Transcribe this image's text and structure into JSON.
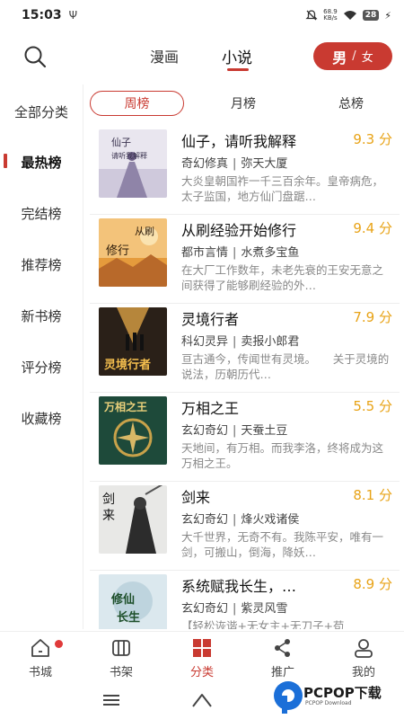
{
  "status_bar": {
    "time": "15:03",
    "left_icon": "usb-icon",
    "net_speed_value": "68.9",
    "net_speed_unit": "KB/s",
    "battery": "28"
  },
  "top_bar": {
    "tabs": [
      {
        "label": "漫画",
        "active": false
      },
      {
        "label": "小说",
        "active": true
      }
    ],
    "gender": {
      "male": "男",
      "separator": "/",
      "female": "女"
    }
  },
  "sidebar": {
    "items": [
      {
        "label": "全部分类",
        "active": false
      },
      {
        "label": "最热榜",
        "active": true
      },
      {
        "label": "完结榜",
        "active": false
      },
      {
        "label": "推荐榜",
        "active": false
      },
      {
        "label": "新书榜",
        "active": false
      },
      {
        "label": "评分榜",
        "active": false
      },
      {
        "label": "收藏榜",
        "active": false
      }
    ]
  },
  "rank_tabs": [
    {
      "label": "周榜",
      "active": true
    },
    {
      "label": "月榜",
      "active": false
    },
    {
      "label": "总榜",
      "active": false
    }
  ],
  "books": [
    {
      "title": "仙子，请听我解释",
      "score": "9.3 分",
      "genre": "奇幻修真",
      "author": "弥天大厦",
      "desc": "大炎皇朝国祚一千三百余年。皇帝病危，太子监国，地方仙门盘踞…"
    },
    {
      "title": "从刷经验开始修行",
      "score": "9.4 分",
      "genre": "都市言情",
      "author": "水煮多宝鱼",
      "desc": "在大厂工作数年，未老先衰的王安无意之间获得了能够刷经验的外…"
    },
    {
      "title": "灵境行者",
      "score": "7.9 分",
      "genre": "科幻灵异",
      "author": "卖报小郎君",
      "desc": "亘古通今，传闻世有灵境。　　关于灵境的说法，历朝历代…"
    },
    {
      "title": "万相之王",
      "score": "5.5 分",
      "genre": "玄幻奇幻",
      "author": "天蚕土豆",
      "desc": "天地间，有万相。而我李洛，终将成为这万相之王。"
    },
    {
      "title": "剑来",
      "score": "8.1 分",
      "genre": "玄幻奇幻",
      "author": "烽火戏诸侯",
      "desc": "大千世界，无奇不有。我陈平安，唯有一剑，可搬山，倒海，降妖…"
    },
    {
      "title": "系统赋我长生，…",
      "score": "8.9 分",
      "genre": "玄幻奇幻",
      "author": "紫灵风雪",
      "desc": "【轻松诙谐+无女主+无刀子+苟"
    }
  ],
  "bottom_nav": [
    {
      "label": "书城",
      "icon": "home-icon",
      "active": false,
      "badge": true
    },
    {
      "label": "书架",
      "icon": "book-icon",
      "active": false,
      "badge": false
    },
    {
      "label": "分类",
      "icon": "grid-icon",
      "active": true,
      "badge": false
    },
    {
      "label": "推广",
      "icon": "share-icon",
      "active": false,
      "badge": false
    },
    {
      "label": "我的",
      "icon": "user-icon",
      "active": false,
      "badge": false
    }
  ],
  "watermark": {
    "title": "PCPOP下载",
    "subtitle": "PCPOP Download"
  },
  "colors": {
    "accent": "#c93a31",
    "score": "#e8a317"
  }
}
